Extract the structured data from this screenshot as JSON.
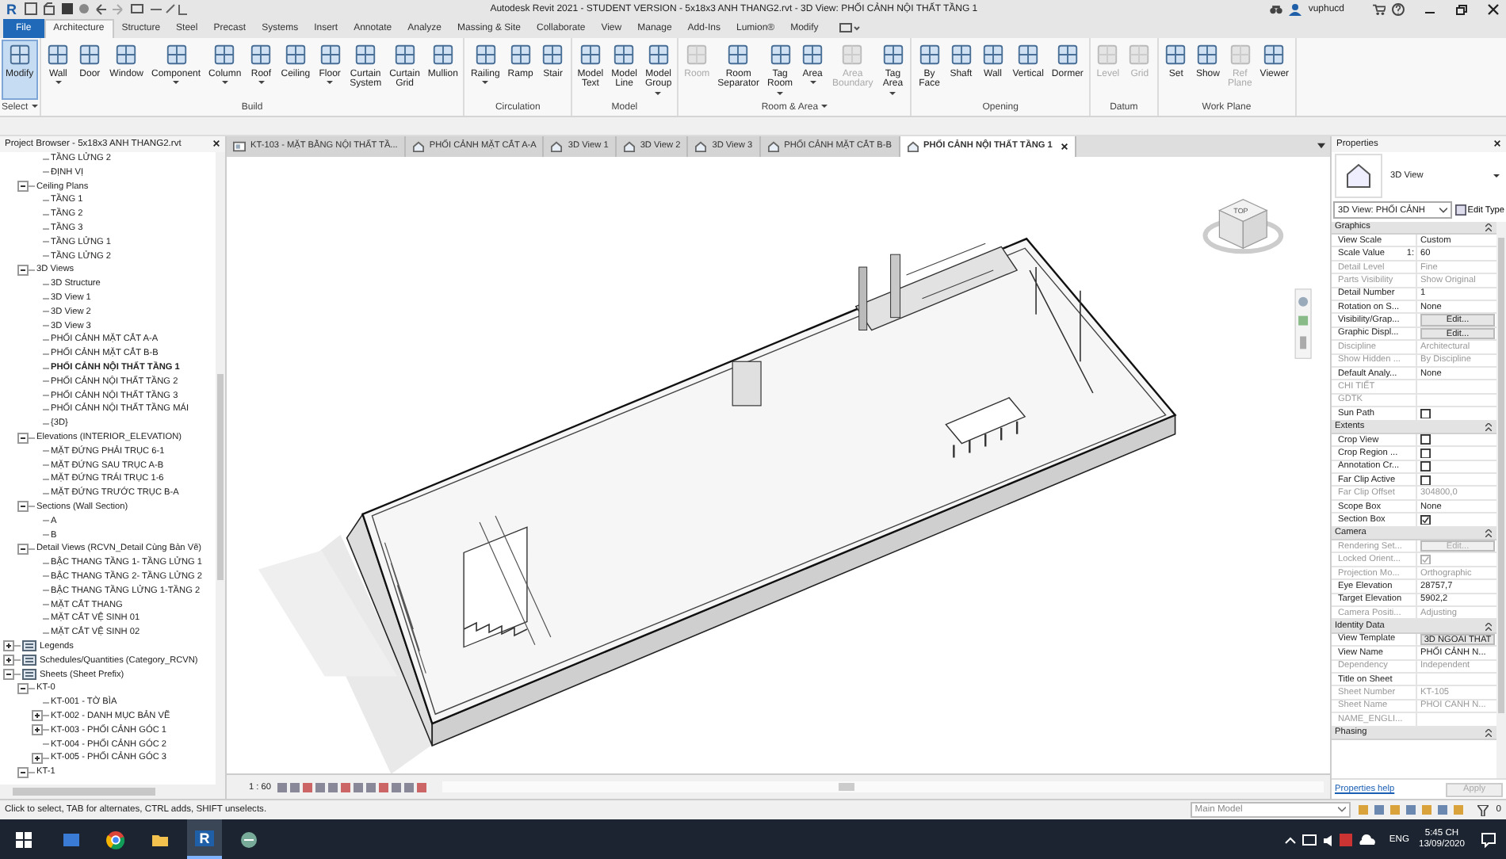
{
  "title_bar": {
    "app_logo": "R",
    "title": "Autodesk Revit 2021 - STUDENT VERSION - 5x18x3 ANH THANG2.rvt - 3D View: PHỐI CẢNH NỘI THẤT TẦNG 1",
    "user": "vuphucd"
  },
  "ribbon": {
    "tabs": [
      {
        "label": "File",
        "kind": "file",
        "selected": false
      },
      {
        "label": "Architecture",
        "kind": "tab",
        "selected": true
      },
      {
        "label": "Structure",
        "kind": "tab",
        "selected": false
      },
      {
        "label": "Steel",
        "kind": "tab",
        "selected": false
      },
      {
        "label": "Precast",
        "kind": "tab",
        "selected": false
      },
      {
        "label": "Systems",
        "kind": "tab",
        "selected": false
      },
      {
        "label": "Insert",
        "kind": "tab",
        "selected": false
      },
      {
        "label": "Annotate",
        "kind": "tab",
        "selected": false
      },
      {
        "label": "Analyze",
        "kind": "tab",
        "selected": false
      },
      {
        "label": "Massing & Site",
        "kind": "tab",
        "selected": false
      },
      {
        "label": "Collaborate",
        "kind": "tab",
        "selected": false
      },
      {
        "label": "View",
        "kind": "tab",
        "selected": false
      },
      {
        "label": "Manage",
        "kind": "tab",
        "selected": false
      },
      {
        "label": "Add-Ins",
        "kind": "tab",
        "selected": false
      },
      {
        "label": "Lumion®",
        "kind": "tab",
        "selected": false
      },
      {
        "label": "Modify",
        "kind": "tab",
        "selected": false
      }
    ],
    "panels": [
      {
        "label": "Select",
        "has_menu": true,
        "buttons": [
          {
            "label": "Modify",
            "dropdown": false,
            "disabled": false,
            "selected": true
          }
        ]
      },
      {
        "label": "Build",
        "has_menu": false,
        "buttons": [
          {
            "label": "Wall",
            "dropdown": true,
            "disabled": false,
            "selected": false
          },
          {
            "label": "Door",
            "dropdown": false,
            "disabled": false,
            "selected": false
          },
          {
            "label": "Window",
            "dropdown": false,
            "disabled": false,
            "selected": false
          },
          {
            "label": "Component",
            "dropdown": true,
            "disabled": false,
            "selected": false
          },
          {
            "label": "Column",
            "dropdown": true,
            "disabled": false,
            "selected": false
          },
          {
            "label": "Roof",
            "dropdown": true,
            "disabled": false,
            "selected": false
          },
          {
            "label": "Ceiling",
            "dropdown": false,
            "disabled": false,
            "selected": false
          },
          {
            "label": "Floor",
            "dropdown": true,
            "disabled": false,
            "selected": false
          },
          {
            "label": "Curtain System",
            "dropdown": false,
            "disabled": false,
            "selected": false
          },
          {
            "label": "Curtain Grid",
            "dropdown": false,
            "disabled": false,
            "selected": false
          },
          {
            "label": "Mullion",
            "dropdown": false,
            "disabled": false,
            "selected": false
          }
        ]
      },
      {
        "label": "Circulation",
        "has_menu": false,
        "buttons": [
          {
            "label": "Railing",
            "dropdown": true,
            "disabled": false,
            "selected": false
          },
          {
            "label": "Ramp",
            "dropdown": false,
            "disabled": false,
            "selected": false
          },
          {
            "label": "Stair",
            "dropdown": false,
            "disabled": false,
            "selected": false
          }
        ]
      },
      {
        "label": "Model",
        "has_menu": false,
        "buttons": [
          {
            "label": "Model Text",
            "dropdown": false,
            "disabled": false,
            "selected": false
          },
          {
            "label": "Model Line",
            "dropdown": false,
            "disabled": false,
            "selected": false
          },
          {
            "label": "Model Group",
            "dropdown": true,
            "disabled": false,
            "selected": false
          }
        ]
      },
      {
        "label": "Room & Area",
        "has_menu": true,
        "buttons": [
          {
            "label": "Room",
            "dropdown": false,
            "disabled": true,
            "selected": false
          },
          {
            "label": "Room Separator",
            "dropdown": false,
            "disabled": false,
            "selected": false
          },
          {
            "label": "Tag Room",
            "dropdown": true,
            "disabled": false,
            "selected": false
          },
          {
            "label": "Area",
            "dropdown": true,
            "disabled": false,
            "selected": false
          },
          {
            "label": "Area Boundary",
            "dropdown": false,
            "disabled": true,
            "selected": false
          },
          {
            "label": "Tag Area",
            "dropdown": true,
            "disabled": false,
            "selected": false
          }
        ]
      },
      {
        "label": "Opening",
        "has_menu": false,
        "buttons": [
          {
            "label": "By Face",
            "dropdown": false,
            "disabled": false,
            "selected": false
          },
          {
            "label": "Shaft",
            "dropdown": false,
            "disabled": false,
            "selected": false
          },
          {
            "label": "Wall",
            "dropdown": false,
            "disabled": false,
            "selected": false
          },
          {
            "label": "Vertical",
            "dropdown": false,
            "disabled": false,
            "selected": false
          },
          {
            "label": "Dormer",
            "dropdown": false,
            "disabled": false,
            "selected": false
          }
        ]
      },
      {
        "label": "Datum",
        "has_menu": false,
        "buttons": [
          {
            "label": "Level",
            "dropdown": false,
            "disabled": true,
            "selected": false
          },
          {
            "label": "Grid",
            "dropdown": false,
            "disabled": true,
            "selected": false
          }
        ]
      },
      {
        "label": "Work Plane",
        "has_menu": false,
        "buttons": [
          {
            "label": "Set",
            "dropdown": false,
            "disabled": false,
            "selected": false
          },
          {
            "label": "Show",
            "dropdown": false,
            "disabled": false,
            "selected": false
          },
          {
            "label": "Ref Plane",
            "dropdown": false,
            "disabled": true,
            "selected": false
          },
          {
            "label": "Viewer",
            "dropdown": false,
            "disabled": false,
            "selected": false
          }
        ]
      }
    ]
  },
  "project_browser": {
    "title": "Project Browser - 5x18x3 ANH THANG2.rvt",
    "tree": [
      {
        "children": [
          {
            "children": [
              {
                "label": "TẦNG LỬNG 2",
                "selected": false
              },
              {
                "label": "ĐỊNH VỊ",
                "selected": false
              }
            ]
          },
          {
            "label": "Ceiling Plans",
            "expanded": true,
            "selected": false,
            "children": [
              {
                "label": "TẦNG 1",
                "selected": false
              },
              {
                "label": "TẦNG 2",
                "selected": false
              },
              {
                "label": "TẦNG 3",
                "selected": false
              },
              {
                "label": "TẦNG LỬNG 1",
                "selected": false
              },
              {
                "label": "TẦNG LỬNG 2",
                "selected": false
              }
            ]
          },
          {
            "label": "3D Views",
            "expanded": true,
            "selected": false,
            "children": [
              {
                "label": "3D Structure",
                "selected": false
              },
              {
                "label": "3D View 1",
                "selected": false
              },
              {
                "label": "3D View 2",
                "selected": false
              },
              {
                "label": "3D View 3",
                "selected": false
              },
              {
                "label": "PHỐI CẢNH MẶT CẮT A-A",
                "selected": false
              },
              {
                "label": "PHỐI CẢNH MẶT CẮT B-B",
                "selected": false
              },
              {
                "label": "PHỐI CẢNH NỘI THẤT TẦNG 1",
                "selected": true
              },
              {
                "label": "PHỐI CẢNH NỘI THẤT TẦNG 2",
                "selected": false
              },
              {
                "label": "PHỐI CẢNH NỘI THẤT TẦNG 3",
                "selected": false
              },
              {
                "label": "PHỐI CẢNH NỘI THẤT TẦNG MÁI",
                "selected": false
              },
              {
                "label": "{3D}",
                "selected": false
              }
            ]
          },
          {
            "label": "Elevations (INTERIOR_ELEVATION)",
            "expanded": true,
            "selected": false,
            "children": [
              {
                "label": "MẶT ĐỨNG PHẢI TRỤC 6-1",
                "selected": false
              },
              {
                "label": "MẶT ĐỨNG SAU TRỤC A-B",
                "selected": false
              },
              {
                "label": "MẶT ĐỨNG TRÁI TRỤC 1-6",
                "selected": false
              },
              {
                "label": "MẶT ĐỨNG TRƯỚC TRỤC B-A",
                "selected": false
              }
            ]
          },
          {
            "label": "Sections (Wall Section)",
            "expanded": true,
            "selected": false,
            "children": [
              {
                "label": "A",
                "selected": false
              },
              {
                "label": "B",
                "selected": false
              }
            ]
          },
          {
            "label": "Detail Views (RCVN_Detail Cùng Bản Vẽ)",
            "expanded": true,
            "selected": false,
            "children": [
              {
                "label": "BẬC THANG TẦNG 1- TẦNG LỬNG 1",
                "selected": false
              },
              {
                "label": "BẬC THANG TẦNG 2- TẦNG LỬNG 2",
                "selected": false
              },
              {
                "label": "BẬC THANG TẦNG LỬNG 1-TẦNG 2",
                "selected": false
              },
              {
                "label": "MẶT CẮT THANG",
                "selected": false
              },
              {
                "label": "MẶT CẮT VỆ SINH 01",
                "selected": false
              },
              {
                "label": "MẶT CẮT VỆ SINH 02",
                "selected": false
              }
            ]
          }
        ]
      },
      {
        "label": "Legends",
        "expanded": false,
        "selected": false
      },
      {
        "label": "Schedules/Quantities (Category_RCVN)",
        "expanded": false,
        "selected": false
      },
      {
        "label": "Sheets (Sheet Prefix)",
        "expanded": true,
        "selected": false,
        "children": [
          {
            "label": "KT-0",
            "expanded": true,
            "selected": false,
            "children": [
              {
                "label": "KT-001 - TỜ BÌA",
                "selected": false
              },
              {
                "label": "KT-002 - DANH MỤC BẢN VẼ",
                "expanded": false,
                "selected": false
              },
              {
                "label": "KT-003 - PHỐI CẢNH GÓC 1",
                "expanded": false,
                "selected": false
              },
              {
                "label": "KT-004 - PHỐI CẢNH GÓC 2",
                "selected": false
              },
              {
                "label": "KT-005 - PHỐI CẢNH GÓC 3",
                "expanded": false,
                "selected": false
              }
            ]
          },
          {
            "label": "KT-1",
            "expanded": true,
            "selected": false
          }
        ]
      }
    ]
  },
  "view_tabs": [
    {
      "label": "KT-103 - MẶT BẰNG NỘI THẤT TẦ...",
      "kind": "sheet",
      "selected": false
    },
    {
      "label": "PHỐI CẢNH MẶT CẮT A-A",
      "kind": "view",
      "selected": false
    },
    {
      "label": "3D View 1",
      "kind": "view",
      "selected": false
    },
    {
      "label": "3D View 2",
      "kind": "view",
      "selected": false
    },
    {
      "label": "3D View 3",
      "kind": "view",
      "selected": false
    },
    {
      "label": "PHỐI CẢNH MẶT CẮT B-B",
      "kind": "view",
      "selected": false
    },
    {
      "label": "PHỐI CẢNH NỘI THẤT TẦNG 1",
      "kind": "view",
      "selected": true
    }
  ],
  "viewport": {
    "view_cube_label": "TOP",
    "scale": "1 : 60"
  },
  "properties": {
    "title": "Properties",
    "type_name": "3D View",
    "selector": "3D View: PHỐI CẢNH",
    "edit_type": "Edit Type",
    "groups": [
      {
        "name": "Graphics",
        "rows": [
          {
            "label": "View Scale",
            "kind": "text",
            "value": "Custom",
            "disabled": false
          },
          {
            "label": "Scale Value",
            "prefix": "1:",
            "kind": "text",
            "value": "60",
            "disabled": false
          },
          {
            "label": "Detail Level",
            "kind": "text",
            "value": "Fine",
            "disabled": true
          },
          {
            "label": "Parts Visibility",
            "kind": "text",
            "value": "Show Original",
            "disabled": true
          },
          {
            "label": "Detail Number",
            "kind": "text",
            "value": "1",
            "disabled": false
          },
          {
            "label": "Rotation on S...",
            "kind": "text",
            "value": "None",
            "disabled": false
          },
          {
            "label": "Visibility/Grap...",
            "kind": "button",
            "value": "Edit...",
            "disabled": false
          },
          {
            "label": "Graphic Displ...",
            "kind": "button",
            "value": "Edit...",
            "disabled": false
          },
          {
            "label": "Discipline",
            "kind": "text",
            "value": "Architectural",
            "disabled": true
          },
          {
            "label": "Show Hidden ...",
            "kind": "text",
            "value": "By Discipline",
            "disabled": true
          },
          {
            "label": "Default Analy...",
            "kind": "text",
            "value": "None",
            "disabled": false
          },
          {
            "label": "CHI TIẾT",
            "kind": "text",
            "disabled": true
          },
          {
            "label": "GDTK",
            "kind": "text",
            "disabled": true
          },
          {
            "label": "Sun Path",
            "kind": "checkbox",
            "checked": false,
            "disabled": false
          }
        ]
      },
      {
        "name": "Extents",
        "rows": [
          {
            "label": "Crop View",
            "kind": "checkbox",
            "checked": false,
            "disabled": false
          },
          {
            "label": "Crop Region ...",
            "kind": "checkbox",
            "checked": false,
            "disabled": false
          },
          {
            "label": "Annotation Cr...",
            "kind": "checkbox",
            "checked": false,
            "disabled": false
          },
          {
            "label": "Far Clip Active",
            "kind": "checkbox",
            "checked": false,
            "disabled": false
          },
          {
            "label": "Far Clip Offset",
            "kind": "text",
            "value": "304800,0",
            "disabled": true
          },
          {
            "label": "Scope Box",
            "kind": "text",
            "value": "None",
            "disabled": false
          },
          {
            "label": "Section Box",
            "kind": "checkbox",
            "checked": true,
            "disabled": false
          }
        ]
      },
      {
        "name": "Camera",
        "rows": [
          {
            "label": "Rendering Set...",
            "kind": "button",
            "value": "Edit...",
            "disabled": true
          },
          {
            "label": "Locked Orient...",
            "kind": "checkbox",
            "checked": true,
            "disabled": true
          },
          {
            "label": "Projection Mo...",
            "kind": "text",
            "value": "Orthographic",
            "disabled": true
          },
          {
            "label": "Eye Elevation",
            "kind": "text",
            "value": "28757,7",
            "disabled": false
          },
          {
            "label": "Target Elevation",
            "kind": "text",
            "value": "5902,2",
            "disabled": false
          },
          {
            "label": "Camera Positi...",
            "kind": "text",
            "value": "Adjusting",
            "disabled": true
          }
        ]
      },
      {
        "name": "Identity Data",
        "rows": [
          {
            "label": "View Template",
            "kind": "button",
            "value": "3D NGOAI THAT",
            "disabled": false
          },
          {
            "label": "View Name",
            "kind": "text",
            "value": "PHỐI CẢNH N...",
            "disabled": false
          },
          {
            "label": "Dependency",
            "kind": "text",
            "value": "Independent",
            "disabled": true
          },
          {
            "label": "Title on Sheet",
            "kind": "text",
            "disabled": false
          },
          {
            "label": "Sheet Number",
            "kind": "text",
            "value": "KT-105",
            "disabled": true
          },
          {
            "label": "Sheet Name",
            "kind": "text",
            "value": "PHỐI CẢNH N...",
            "disabled": true
          },
          {
            "label": "NAME_ENGLI...",
            "kind": "text",
            "disabled": true
          }
        ]
      },
      {
        "name": "Phasing"
      }
    ],
    "help_link": "Properties help",
    "apply": {
      "label": "Apply",
      "disabled": true
    }
  },
  "status_bar": {
    "message": "Click to select, TAB for alternates, CTRL adds, SHIFT unselects.",
    "workset": "Main Model",
    "filter_count": "0"
  },
  "taskbar": {
    "apps": [
      {
        "kind": "task-view",
        "selected": false
      },
      {
        "kind": "browser",
        "selected": false
      },
      {
        "kind": "folder",
        "selected": false
      },
      {
        "kind": "revit",
        "label": "R",
        "selected": true
      },
      {
        "kind": "app",
        "selected": false
      }
    ],
    "language": "ENG",
    "time": "5:45 CH",
    "date": "13/09/2020"
  }
}
